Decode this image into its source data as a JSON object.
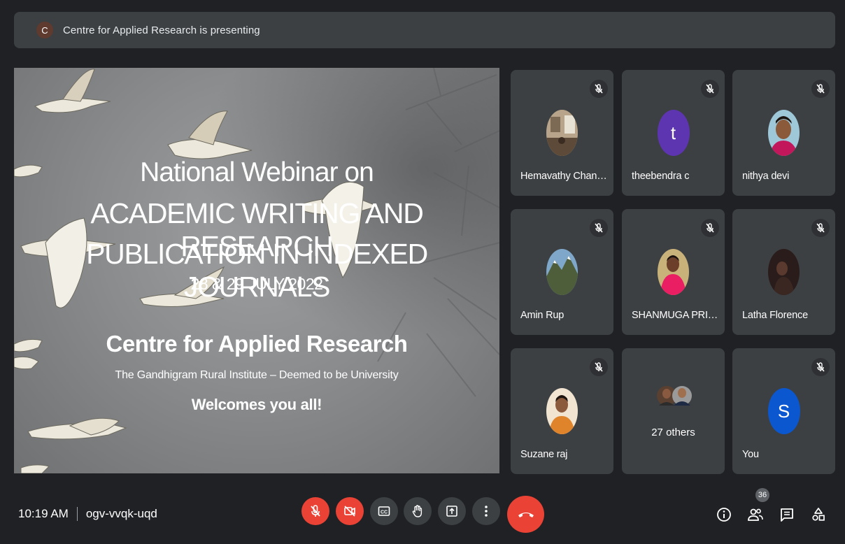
{
  "presentation_bar": {
    "presenter_initial": "C",
    "text": "Centre for Applied Research is presenting"
  },
  "slide": {
    "line1": "National Webinar on",
    "line2": "ACADEMIC WRITING AND RESEARCH",
    "line3": "PUBLICATION IN INDEXED JOURNALS",
    "date": "28 & 29 JULY 2022",
    "organizer": "Centre for Applied Research",
    "institute": "The Gandhigram Rural Institute – Deemed to be University",
    "welcome": "Welcomes you all!"
  },
  "participants": [
    {
      "name": "Hemavathy Chand...",
      "muted": true,
      "avatar": "photo"
    },
    {
      "name": "theebendra c",
      "muted": true,
      "avatar": "letter",
      "initial": "t",
      "color": "#5e35b1"
    },
    {
      "name": "nithya devi",
      "muted": true,
      "avatar": "photo"
    },
    {
      "name": "Amin Rup",
      "muted": true,
      "avatar": "photo"
    },
    {
      "name": "SHANMUGA PRIYA",
      "muted": true,
      "avatar": "photo"
    },
    {
      "name": "Latha Florence",
      "muted": true,
      "avatar": "photo"
    },
    {
      "name": "Suzane raj",
      "muted": true,
      "avatar": "photo"
    },
    {
      "name": "27 others",
      "muted": false,
      "avatar": "group"
    },
    {
      "name": "You",
      "muted": true,
      "avatar": "letter",
      "initial": "S",
      "color": "#0b57d0"
    }
  ],
  "meeting": {
    "time": "10:19 AM",
    "code": "ogv-vvqk-uqd"
  },
  "controls": [
    "mic-off",
    "camera-off",
    "captions",
    "raise-hand",
    "present-screen",
    "more-options",
    "leave-call"
  ],
  "people_count": "36",
  "colors": {
    "background": "#202124",
    "tile": "#3c4043",
    "danger": "#ea4335"
  }
}
